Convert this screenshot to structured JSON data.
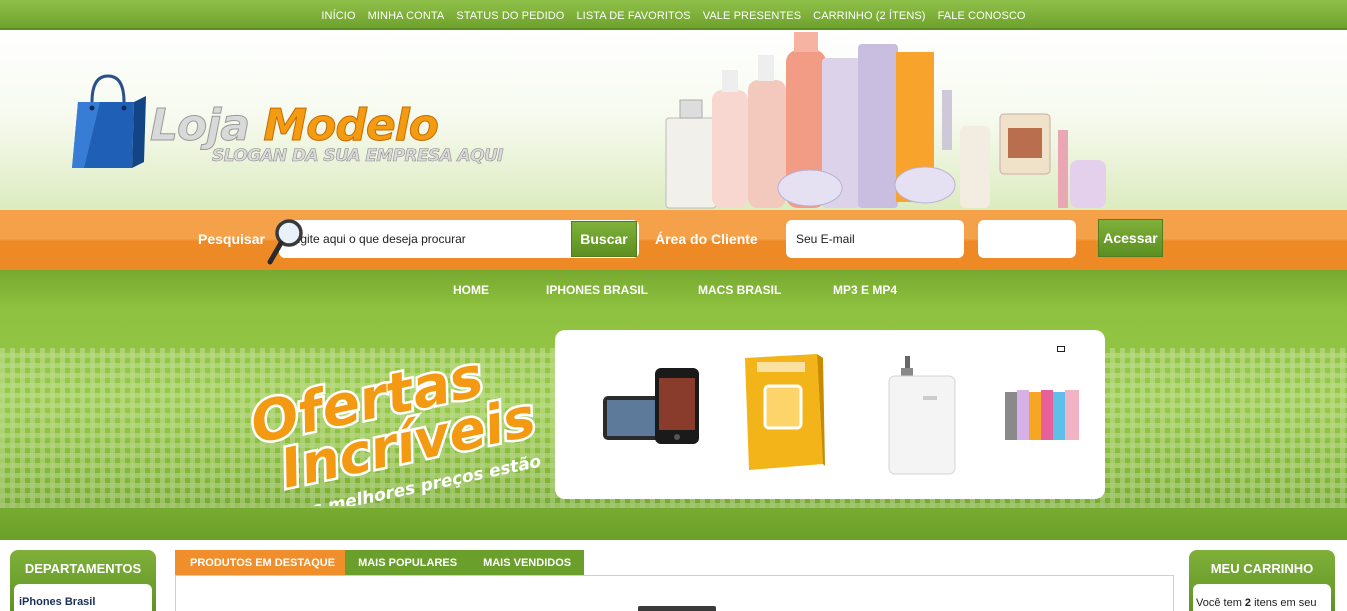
{
  "topnav": {
    "items": [
      "INÍCIO",
      "MINHA CONTA",
      "STATUS DO PEDIDO",
      "LISTA DE FAVORITOS",
      "VALE PRESENTES",
      "CARRINHO (2 ÍTENS)",
      "FALE CONOSCO"
    ]
  },
  "logo": {
    "word1": "Loja",
    "word2": "Modelo",
    "slogan": "SLOGAN DA SUA EMPRESA AQUI"
  },
  "search": {
    "label": "Pesquisar",
    "placeholder": "Digite aqui o que deseja procurar",
    "button": "Buscar"
  },
  "client_area": {
    "label": "Área do Cliente",
    "email_placeholder": "Seu E-mail",
    "password_placeholder": "",
    "button": "Acessar"
  },
  "mainmenu": {
    "items": [
      "HOME",
      "IPHONES BRASIL",
      "MACS BRASIL",
      "MP3 E MP4"
    ]
  },
  "banner": {
    "line1": "Ofertas",
    "line2": "Incríveis",
    "tagline": "os melhores preços estão aqui!"
  },
  "departments": {
    "title": "DEPARTAMENTOS",
    "first_item": "iPhones Brasil"
  },
  "tabs": {
    "items": [
      "PRODUTOS EM DESTAQUE",
      "MAIS POPULARES",
      "MAIS VENDIDOS"
    ]
  },
  "cart": {
    "title": "MEU CARRINHO",
    "text_pre": "Você tem ",
    "count": "2",
    "text_post": " itens em seu"
  },
  "colors": {
    "green": "#7fb03a",
    "orange": "#ef8e2a",
    "white": "#ffffff"
  }
}
